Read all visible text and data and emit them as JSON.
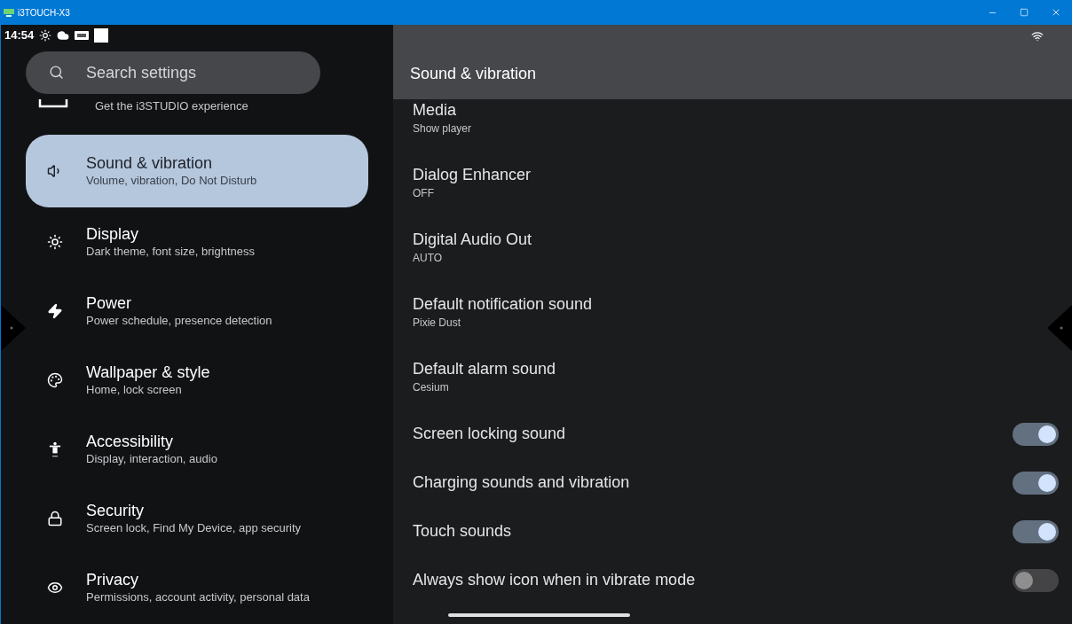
{
  "window": {
    "title": "i3TOUCH-X3"
  },
  "status_bar": {
    "time": "14:54"
  },
  "search": {
    "placeholder": "Search settings"
  },
  "sidebar": {
    "items": [
      {
        "kind": "partial",
        "subtitle": "Get the i3STUDIO experience",
        "selected": false
      },
      {
        "kind": "sound",
        "title": "Sound & vibration",
        "subtitle": "Volume, vibration, Do Not Disturb",
        "selected": true
      },
      {
        "kind": "display",
        "title": "Display",
        "subtitle": "Dark theme, font size, brightness",
        "selected": false
      },
      {
        "kind": "power",
        "title": "Power",
        "subtitle": "Power schedule, presence detection",
        "selected": false
      },
      {
        "kind": "palette",
        "title": "Wallpaper & style",
        "subtitle": "Home, lock screen",
        "selected": false
      },
      {
        "kind": "accessibility",
        "title": "Accessibility",
        "subtitle": "Display, interaction, audio",
        "selected": false
      },
      {
        "kind": "lock",
        "title": "Security",
        "subtitle": "Screen lock, Find My Device, app security",
        "selected": false
      },
      {
        "kind": "privacy",
        "title": "Privacy",
        "subtitle": "Permissions, account activity, personal data",
        "selected": false
      }
    ]
  },
  "page": {
    "title": "Sound & vibration",
    "settings": [
      {
        "kind": "text",
        "title": "Media",
        "value": "Show player"
      },
      {
        "kind": "text",
        "title": "Dialog Enhancer",
        "value": "OFF"
      },
      {
        "kind": "text",
        "title": "Digital Audio Out",
        "value": "AUTO"
      },
      {
        "kind": "text",
        "title": "Default notification sound",
        "value": "Pixie Dust"
      },
      {
        "kind": "text",
        "title": "Default alarm sound",
        "value": "Cesium"
      },
      {
        "kind": "toggle",
        "title": "Screen locking sound",
        "on": true
      },
      {
        "kind": "toggle",
        "title": "Charging sounds and vibration",
        "on": true
      },
      {
        "kind": "toggle",
        "title": "Touch sounds",
        "on": true
      },
      {
        "kind": "toggle",
        "title": "Always show icon when in vibrate mode",
        "on": false
      }
    ]
  }
}
